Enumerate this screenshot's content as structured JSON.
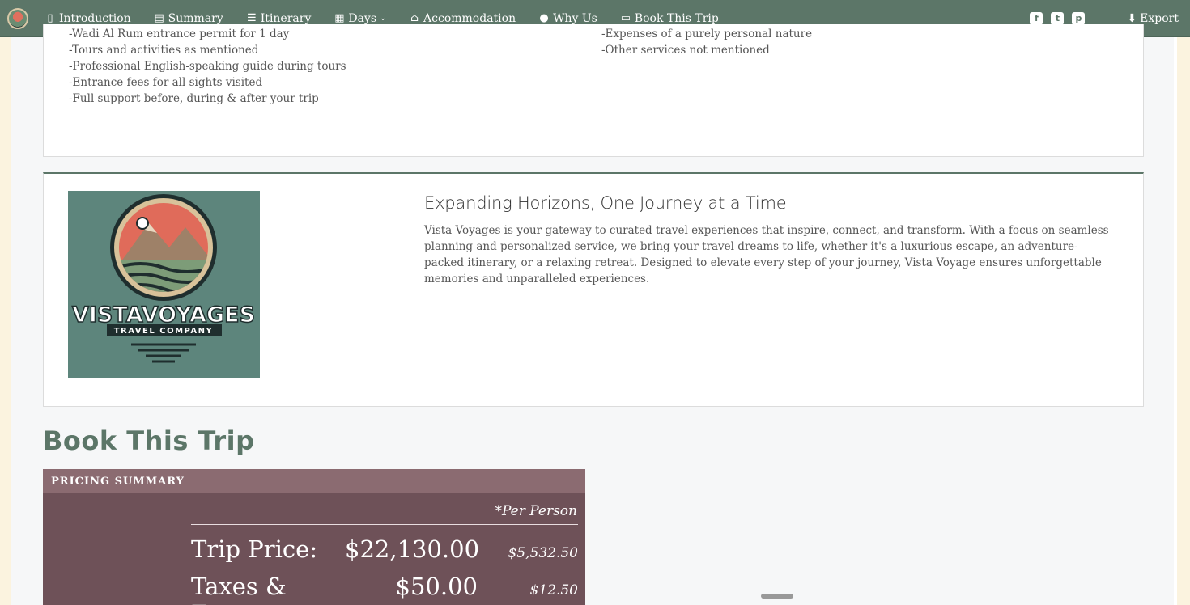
{
  "nav": {
    "items": [
      {
        "label": "Introduction",
        "icon": "book-open-icon"
      },
      {
        "label": "Summary",
        "icon": "list-alt-icon"
      },
      {
        "label": "Itinerary",
        "icon": "list-icon"
      },
      {
        "label": "Days",
        "icon": "calendar-icon"
      },
      {
        "label": "Accommodation",
        "icon": "home-icon"
      },
      {
        "label": "Why Us",
        "icon": "comment-icon"
      },
      {
        "label": "Book This Trip",
        "icon": "credit-card-icon"
      }
    ],
    "export_label": "Export"
  },
  "includes": {
    "left": [
      "-Wadi Al Rum entrance permit for 1 day",
      "-Tours and activities as mentioned",
      "-Professional English-speaking guide during tours",
      "-Entrance fees for all sights visited",
      "-Full support before, during & after your trip"
    ],
    "right": [
      "-Expenses of a purely personal nature",
      "-Other services not mentioned"
    ]
  },
  "about": {
    "logo_name": "VISTAVOYAGES",
    "logo_tagline": "TRAVEL COMPANY",
    "title": "Expanding Horizons, One Journey at a Time",
    "body": "Vista Voyages is your gateway to curated travel experiences that inspire, connect, and transform. With a focus on seamless planning and personalized service, we bring your travel dreams to life, whether it's a luxurious escape, an adventure-packed itinerary, or a relaxing retreat. Designed to elevate every step of your journey, Vista Voyage ensures unforgettable memories and unparalleled experiences."
  },
  "book": {
    "heading": "Book This Trip",
    "pricing_header": "PRICING SUMMARY",
    "per_person": "*Per Person",
    "rows": [
      {
        "label": "Trip Price:",
        "amount": "$22,130.00",
        "per_person": "$5,532.50"
      },
      {
        "label": "Taxes & Fees:",
        "amount": "$50.00",
        "per_person": "$12.50"
      }
    ]
  },
  "colors": {
    "nav_bg": "#5c7668",
    "pricing_bg": "#6e5158",
    "pricing_header_bg": "#8b6b71"
  }
}
